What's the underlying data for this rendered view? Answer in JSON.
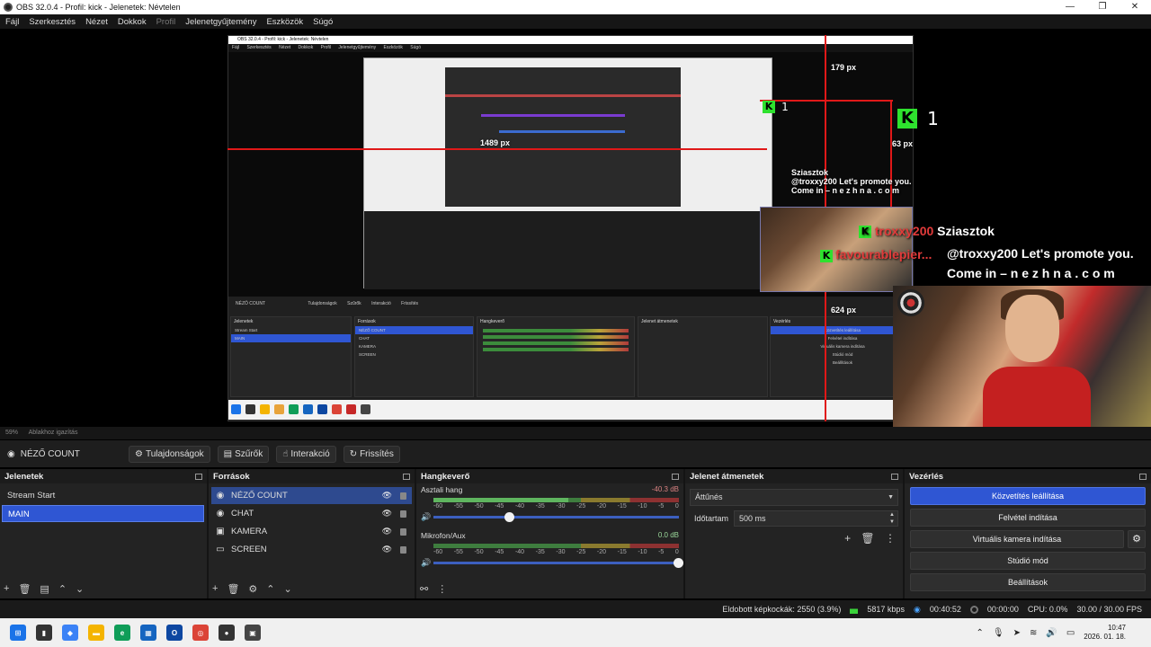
{
  "window": {
    "title": "OBS 32.0.4 - Profil: kick - Jelenetek: Névtelen",
    "controls": [
      "—",
      "❐",
      "✕"
    ]
  },
  "menu": [
    "Fájl",
    "Szerkesztés",
    "Nézet",
    "Dokkok",
    "Profil",
    "Jelenetgyűjtemény",
    "Eszközök",
    "Súgó"
  ],
  "preview": {
    "dim_labels": {
      "top": "179 px",
      "right": "63 px",
      "left": "1489 px",
      "bottom": "624 px",
      "inner_top": "179 px",
      "inner_left": "1489 px",
      "inner_bottom": "624 px"
    },
    "overlay": {
      "kick_count": "1",
      "chat": [
        {
          "name": "troxxy200",
          "text": "Sziasztok"
        },
        {
          "name": "",
          "text": "@troxxy200 Let's promote you."
        },
        {
          "name": "",
          "text": "Come in – n e z h n a . c o m"
        }
      ],
      "mod_name": "favourablepier..."
    },
    "nested": {
      "title": "OBS 32.0.4 - Profil: kick - Jelenetek: Névtelen",
      "menu": [
        "Fájl",
        "Szerkesztés",
        "Nézet",
        "Dokkok",
        "Profil",
        "Jelenetgyűjtemény",
        "Eszközök",
        "Súgó"
      ],
      "toolbar": [
        "NÉZŐ COUNT",
        "Tulajdonságok",
        "Szűrők",
        "Interakció",
        "Frissítés"
      ],
      "scenes_title": "Jelenetek",
      "scenes": [
        "Stream Start",
        "MAIN"
      ],
      "sources_title": "Források",
      "sources": [
        "NÉZŐ COUNT",
        "CHAT",
        "KAMERA",
        "SCREEN"
      ],
      "mixer_title": "Hangkeverő",
      "trans_title": "Jelenet átmenetek",
      "ctl_title": "Vezérlés",
      "ctl_buttons": [
        "Közvetítés leállítása",
        "Felvétel indítása",
        "Virtuális kamera indítása",
        "Stúdió mód",
        "Beállítások"
      ]
    }
  },
  "preview_status": {
    "zoom": "59%",
    "mode": "Ablakhoz igazítás"
  },
  "source_toolbar": {
    "selected_source": "NÉZŐ COUNT",
    "properties": "Tulajdonságok",
    "filters": "Szűrők",
    "interact": "Interakció",
    "refresh": "Frissítés"
  },
  "scenes": {
    "title": "Jelenetek",
    "items": [
      {
        "label": "Stream Start",
        "selected": false
      },
      {
        "label": "MAIN",
        "selected": true
      }
    ]
  },
  "sources": {
    "title": "Források",
    "items": [
      {
        "label": "NÉZŐ COUNT",
        "icon": "globe-icon",
        "selected": true
      },
      {
        "label": "CHAT",
        "icon": "globe-icon",
        "selected": false
      },
      {
        "label": "KAMERA",
        "icon": "camera-icon",
        "selected": false
      },
      {
        "label": "SCREEN",
        "icon": "monitor-icon",
        "selected": false
      }
    ]
  },
  "mixer": {
    "title": "Hangkeverő",
    "channels": [
      {
        "name": "Asztali hang",
        "db": "-40.3 dB",
        "fader": 0.31
      },
      {
        "name": "Mikrofon/Aux",
        "db": "0.0 dB",
        "fader": 1.0
      }
    ],
    "scale": [
      "-60",
      "-55",
      "-50",
      "-45",
      "-40",
      "-35",
      "-30",
      "-25",
      "-20",
      "-15",
      "-10",
      "-5",
      "0"
    ]
  },
  "transitions": {
    "title": "Jelenet átmenetek",
    "selected": "Áttűnés",
    "duration_label": "Időtartam",
    "duration_value": "500 ms"
  },
  "controls": {
    "title": "Vezérlés",
    "stream": "Közvetítés leállítása",
    "record": "Felvétel indítása",
    "virtualcam": "Virtuális kamera indítása",
    "studio": "Stúdió mód",
    "settings": "Beállítások"
  },
  "status": {
    "dropped": "Eldobott képkockák: 2550 (3.9%)",
    "bitrate": "5817 kbps",
    "stream_time": "00:40:52",
    "rec_time": "00:00:00",
    "cpu": "CPU: 0.0%",
    "fps": "30.00 / 30.00 FPS"
  },
  "taskbar": {
    "time": "10:47",
    "date": "2026. 01. 18."
  },
  "colors": {
    "accent": "#2f56d3",
    "kick_green": "#2ee12e",
    "guide_red": "#e01818"
  }
}
